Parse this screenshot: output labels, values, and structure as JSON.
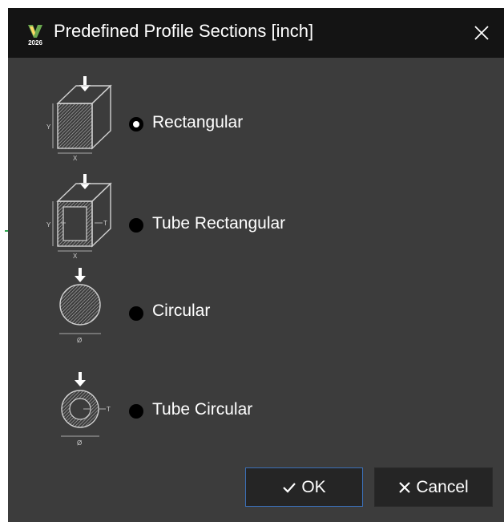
{
  "dialog": {
    "title": "Predefined Profile Sections [inch]",
    "app_icon_badge": "2026",
    "close_icon": "close-icon"
  },
  "options": [
    {
      "label": "Rectangular",
      "checked": true,
      "icon": "rectangular-section-icon",
      "dims": [
        "Y",
        "X"
      ]
    },
    {
      "label": "Tube Rectangular",
      "checked": false,
      "icon": "tube-rectangular-section-icon",
      "dims": [
        "Y",
        "X",
        "T"
      ]
    },
    {
      "label": "Circular",
      "checked": false,
      "icon": "circular-section-icon",
      "dims": [
        "Ø"
      ]
    },
    {
      "label": "Tube Circular",
      "checked": false,
      "icon": "tube-circular-section-icon",
      "dims": [
        "Ø",
        "T"
      ]
    }
  ],
  "buttons": {
    "ok_label": "OK",
    "ok_icon": "check-icon",
    "cancel_label": "Cancel",
    "cancel_icon": "x-icon"
  },
  "colors": {
    "titlebar": "#141414",
    "body": "#3c3c3c",
    "button": "#252525",
    "ok_border": "#3b6fb6"
  }
}
